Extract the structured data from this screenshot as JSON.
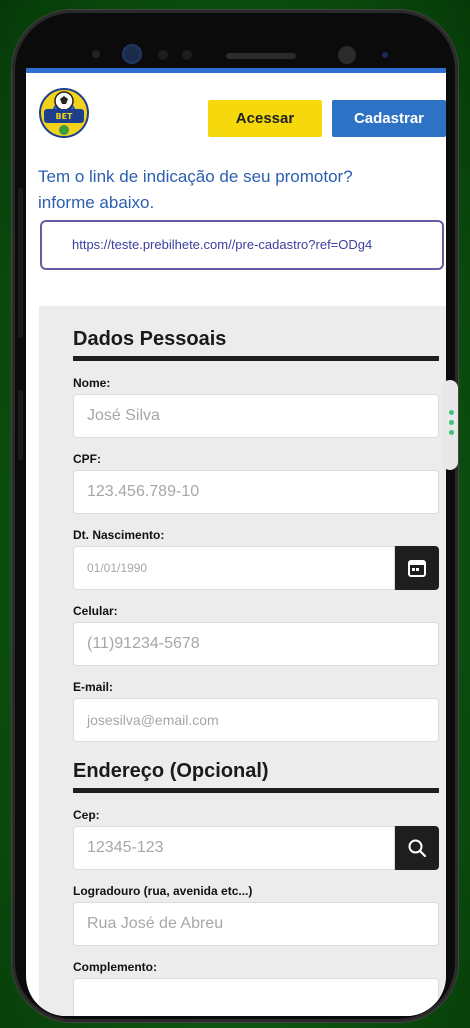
{
  "header": {
    "logo_alt": "BET Esportivos",
    "login_label": "Acessar",
    "register_label": "Cadastrar"
  },
  "referral": {
    "prompt_line1": "Tem o link de indicação de seu promotor?",
    "prompt_line2": "informe abaixo.",
    "link_value": "https://teste.prebilhete.com//pre-cadastro?ref=ODg4"
  },
  "personal": {
    "title": "Dados Pessoais",
    "name_label": "Nome:",
    "name_placeholder": "José Silva",
    "cpf_label": "CPF:",
    "cpf_placeholder": "123.456.789-10",
    "birth_label": "Dt. Nascimento:",
    "birth_placeholder": "01/01/1990",
    "phone_label": "Celular:",
    "phone_placeholder": "(11)91234-5678",
    "email_label": "E-mail:",
    "email_placeholder": "josesilva@email.com"
  },
  "address": {
    "title": "Endereço (Opcional)",
    "cep_label": "Cep:",
    "cep_placeholder": "12345-123",
    "street_label": "Logradouro (rua, avenida etc...)",
    "street_placeholder": "Rua José de Abreu",
    "complement_label": "Complemento:"
  },
  "colors": {
    "accent_blue": "#2d72c4",
    "accent_yellow": "#f5d90c",
    "link_text": "#2b5fb0"
  },
  "icons": [
    "calendar-icon",
    "search-icon",
    "logo-ball-icon"
  ]
}
